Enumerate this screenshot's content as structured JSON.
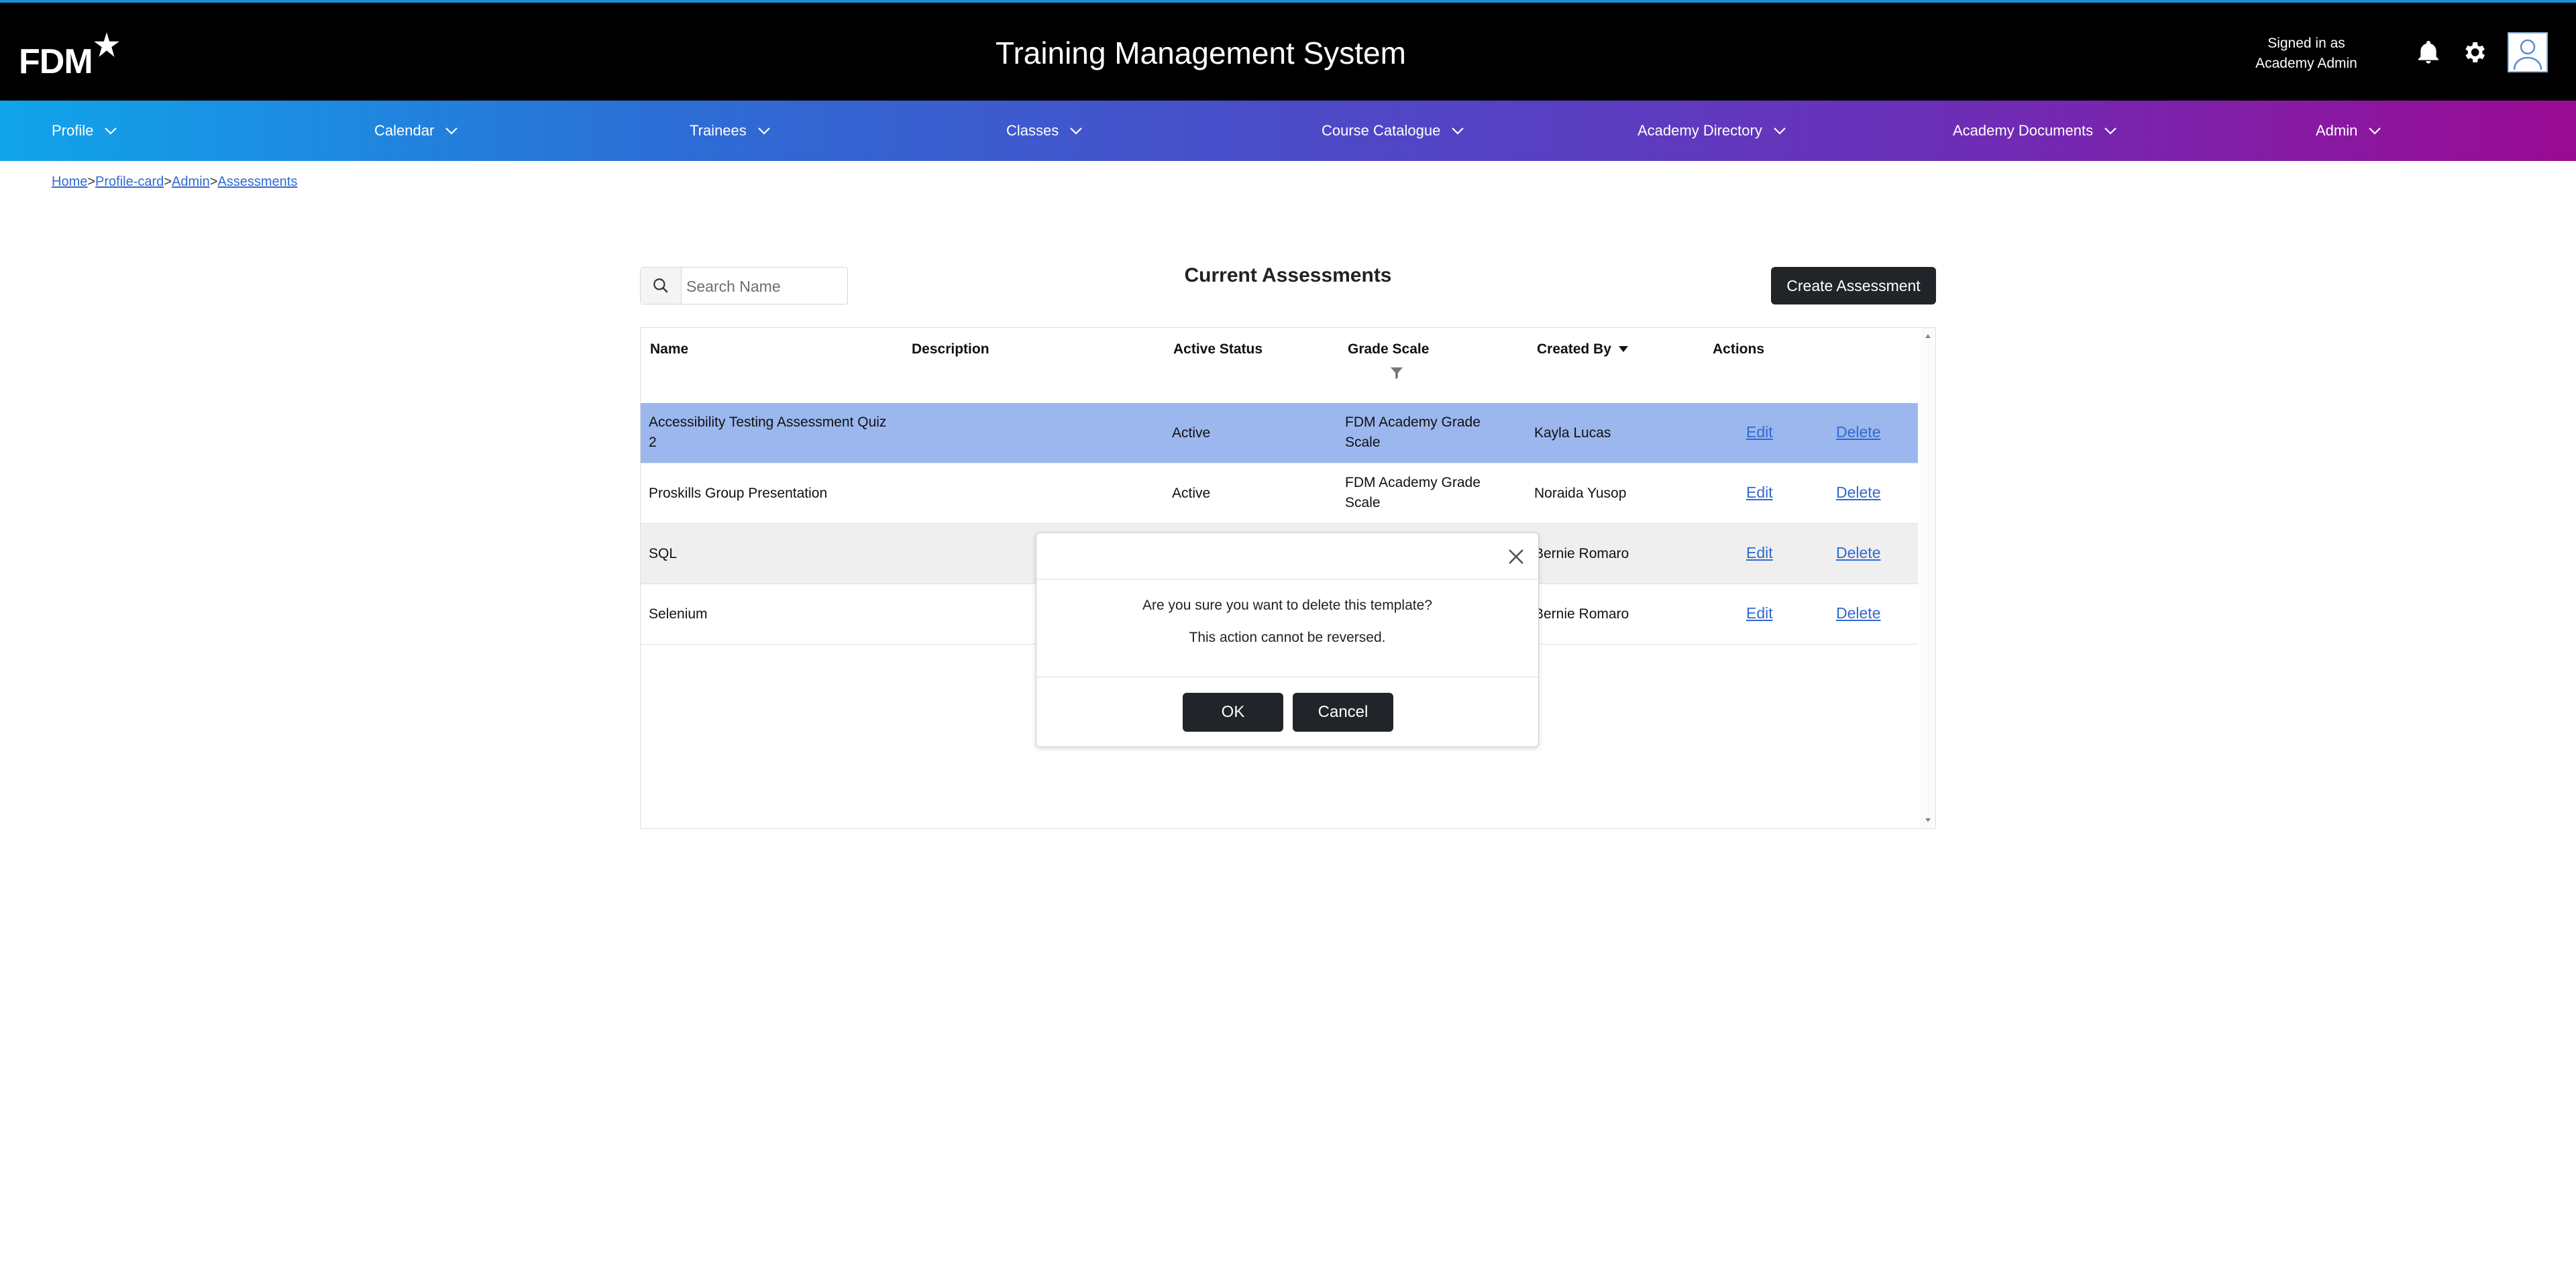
{
  "header": {
    "logo_text": "FDM",
    "app_title": "Training Management System",
    "signed_in_line1": "Signed in as",
    "signed_in_line2": "Academy Admin",
    "icons": [
      "bell-icon",
      "gear-icon",
      "avatar-icon"
    ]
  },
  "nav": {
    "items": [
      {
        "label": "Profile"
      },
      {
        "label": "Calendar"
      },
      {
        "label": "Trainees"
      },
      {
        "label": "Classes"
      },
      {
        "label": "Course Catalogue"
      },
      {
        "label": "Academy Directory"
      },
      {
        "label": "Academy Documents"
      },
      {
        "label": "Admin"
      }
    ],
    "gradient": [
      "#10a5ea",
      "#9b0a93"
    ]
  },
  "breadcrumb": {
    "items": [
      "Home",
      "Profile-card",
      "Admin",
      "Assessments"
    ],
    "separator": ">"
  },
  "search": {
    "placeholder": "Search Name"
  },
  "main": {
    "title": "Current Assessments",
    "create_label": "Create Assessment"
  },
  "table": {
    "columns": [
      "Name",
      "Description",
      "Active Status",
      "Grade Scale",
      "Created By",
      "Actions"
    ],
    "sorted_column": "Created By",
    "rows": [
      {
        "name": "Accessibility Testing Assessment Quiz 2",
        "description": "",
        "status": "Active",
        "grade": "FDM Academy Grade Scale",
        "creator": "Kayla Lucas",
        "edit": "Edit",
        "delete": "Delete"
      },
      {
        "name": "Proskills Group Presentation",
        "description": "",
        "status": "Active",
        "grade": "FDM Academy Grade Scale",
        "creator": "Noraida Yusop",
        "edit": "Edit",
        "delete": "Delete"
      },
      {
        "name": "SQL",
        "description": "",
        "status": "",
        "grade": "",
        "creator": "Bernie Romaro",
        "edit": "Edit",
        "delete": "Delete"
      },
      {
        "name": "Selenium",
        "description": "",
        "status": "",
        "grade": "",
        "creator": "Bernie Romaro",
        "edit": "Edit",
        "delete": "Delete"
      }
    ],
    "selected_row_color": "#9bb7ee"
  },
  "modal": {
    "message": "Are you sure you want to delete this template?",
    "warning": "This action cannot be reversed.",
    "ok_label": "OK",
    "cancel_label": "Cancel"
  },
  "colors": {
    "link": "#2f6ad1",
    "dark_button": "#212529",
    "header_bg": "#000000"
  }
}
